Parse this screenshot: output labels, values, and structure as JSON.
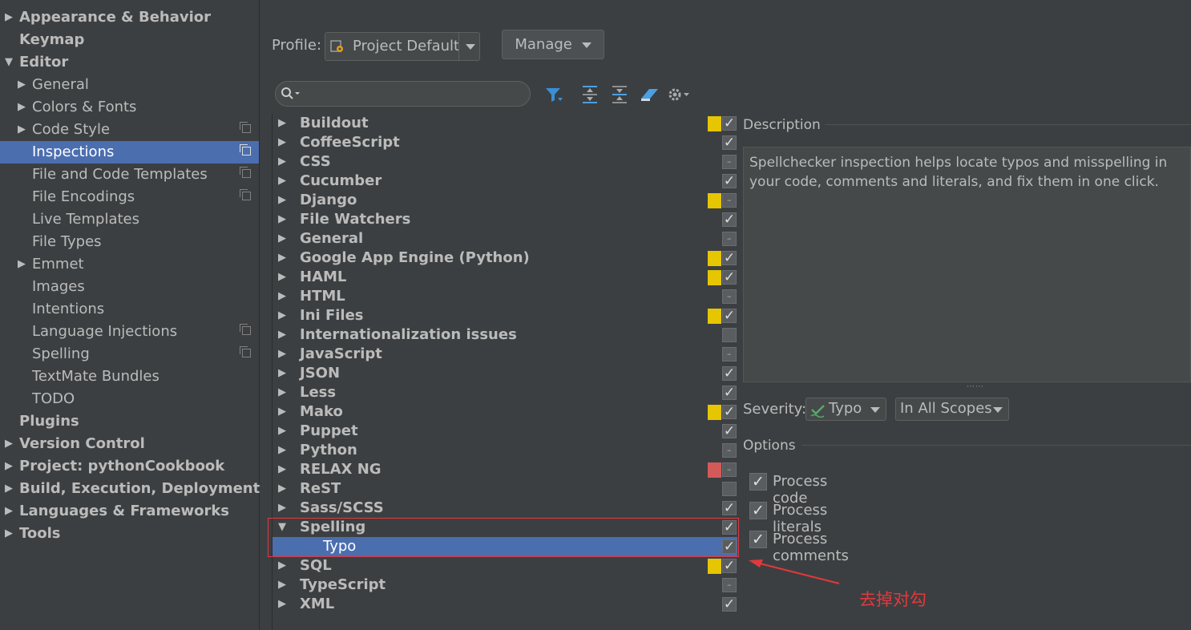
{
  "sidebar": {
    "items": [
      {
        "label": "Appearance & Behavior",
        "arrow": "right",
        "bold": true
      },
      {
        "label": "Keymap",
        "bold": true
      },
      {
        "label": "Editor",
        "arrow": "down",
        "bold": true
      },
      {
        "label": "General",
        "arrow": "right"
      },
      {
        "label": "Colors & Fonts",
        "arrow": "right"
      },
      {
        "label": "Code Style",
        "arrow": "right",
        "copy": true
      },
      {
        "label": "Inspections",
        "selected": true,
        "copy": true
      },
      {
        "label": "File and Code Templates",
        "copy": true
      },
      {
        "label": "File Encodings",
        "copy": true
      },
      {
        "label": "Live Templates"
      },
      {
        "label": "File Types"
      },
      {
        "label": "Emmet",
        "arrow": "right"
      },
      {
        "label": "Images"
      },
      {
        "label": "Intentions"
      },
      {
        "label": "Language Injections",
        "copy": true
      },
      {
        "label": "Spelling",
        "copy": true
      },
      {
        "label": "TextMate Bundles"
      },
      {
        "label": "TODO"
      },
      {
        "label": "Plugins",
        "bold": true
      },
      {
        "label": "Version Control",
        "arrow": "right",
        "bold": true
      },
      {
        "label": "Project: pythonCookbook",
        "arrow": "right",
        "bold": true
      },
      {
        "label": "Build, Execution, Deployment",
        "arrow": "right",
        "bold": true
      },
      {
        "label": "Languages & Frameworks",
        "arrow": "right",
        "bold": true
      },
      {
        "label": "Tools",
        "arrow": "right",
        "bold": true
      }
    ]
  },
  "profile": {
    "label": "Profile:",
    "value": "Project Default"
  },
  "manage": {
    "label": "Manage"
  },
  "search": {
    "placeholder": ""
  },
  "tree": {
    "rows": [
      {
        "label": "Buildout",
        "arrow": "right",
        "swatch": "#e5c600",
        "check": "checked"
      },
      {
        "label": "CoffeeScript",
        "arrow": "right",
        "check": "checked"
      },
      {
        "label": "CSS",
        "arrow": "right",
        "check": "mixed"
      },
      {
        "label": "Cucumber",
        "arrow": "right",
        "check": "checked"
      },
      {
        "label": "Django",
        "arrow": "right",
        "swatch": "#e5c600",
        "check": "mixed"
      },
      {
        "label": "File Watchers",
        "arrow": "right",
        "check": "checked"
      },
      {
        "label": "General",
        "arrow": "right",
        "check": "mixed"
      },
      {
        "label": "Google App Engine (Python)",
        "arrow": "right",
        "swatch": "#e5c600",
        "check": "checked"
      },
      {
        "label": "HAML",
        "arrow": "right",
        "swatch": "#e5c600",
        "check": "checked"
      },
      {
        "label": "HTML",
        "arrow": "right",
        "check": "mixed"
      },
      {
        "label": "Ini Files",
        "arrow": "right",
        "swatch": "#e5c600",
        "check": "checked"
      },
      {
        "label": "Internationalization issues",
        "arrow": "right",
        "check": "unchecked"
      },
      {
        "label": "JavaScript",
        "arrow": "right",
        "check": "mixed"
      },
      {
        "label": "JSON",
        "arrow": "right",
        "check": "checked"
      },
      {
        "label": "Less",
        "arrow": "right",
        "check": "checked"
      },
      {
        "label": "Mako",
        "arrow": "right",
        "swatch": "#e5c600",
        "check": "checked"
      },
      {
        "label": "Puppet",
        "arrow": "right",
        "check": "checked"
      },
      {
        "label": "Python",
        "arrow": "right",
        "check": "mixed"
      },
      {
        "label": "RELAX NG",
        "arrow": "right",
        "swatch": "#d45a5a",
        "check": "mixed"
      },
      {
        "label": "ReST",
        "arrow": "right",
        "check": "unchecked"
      },
      {
        "label": "Sass/SCSS",
        "arrow": "right",
        "check": "checked"
      },
      {
        "label": "Spelling",
        "arrow": "down",
        "check": "checked"
      },
      {
        "label": "Typo",
        "child": true,
        "selected": true,
        "check": "checked"
      },
      {
        "label": "SQL",
        "arrow": "right",
        "swatch": "#e5c600",
        "check": "checked"
      },
      {
        "label": "TypeScript",
        "arrow": "right",
        "check": "mixed"
      },
      {
        "label": "XML",
        "arrow": "right",
        "check": "checked"
      }
    ]
  },
  "description": {
    "title": "Description",
    "text": "Spellchecker inspection helps locate typos and misspelling in your code, comments and literals, and fix them in one click."
  },
  "severity": {
    "label": "Severity:",
    "value": "Typo",
    "scope": "In All Scopes"
  },
  "options": {
    "title": "Options",
    "items": [
      {
        "label": "Process code",
        "checked": true
      },
      {
        "label": "Process literals",
        "checked": true
      },
      {
        "label": "Process comments",
        "checked": true
      }
    ]
  },
  "annotation": {
    "text": "去掉对勾",
    "color": "#e0393e"
  }
}
